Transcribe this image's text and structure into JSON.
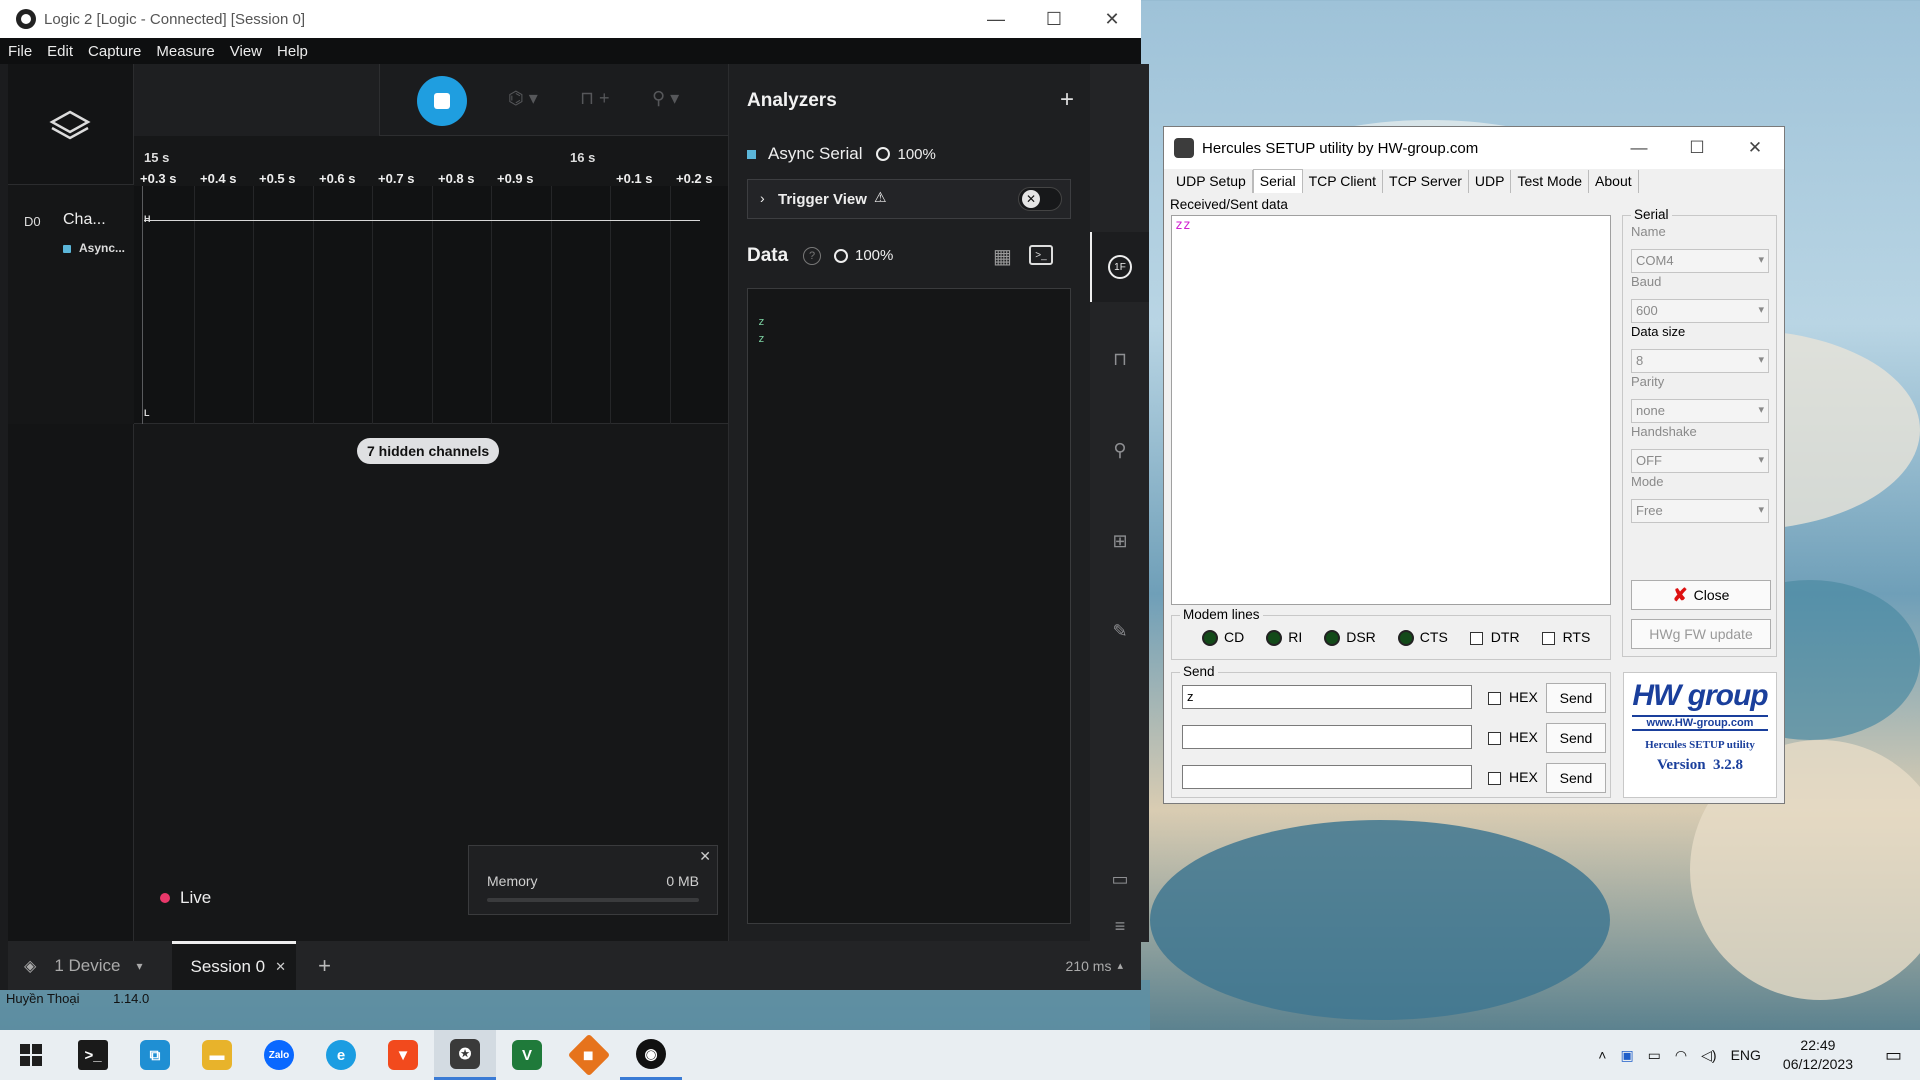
{
  "logic": {
    "title": "Logic 2 [Logic - Connected] [Session 0]",
    "menu": [
      "File",
      "Edit",
      "Capture",
      "Measure",
      "View",
      "Help"
    ],
    "time_major": [
      "15 s",
      "16 s"
    ],
    "time_ticks": [
      "+0.3 s",
      "+0.4 s",
      "+0.5 s",
      "+0.6 s",
      "+0.7 s",
      "+0.8 s",
      "+0.9 s",
      "+0.1 s",
      "+0.2 s"
    ],
    "channel": {
      "id": "D0",
      "name": "Cha...",
      "analyzer": "Async...",
      "high": "H",
      "low": "L"
    },
    "hidden_channels": "7 hidden channels",
    "analyzers_title": "Analyzers",
    "analyzer_item": {
      "name": "Async Serial",
      "pct": "100%"
    },
    "trigger_view": "Trigger View",
    "data_title": "Data",
    "data_pct": "100%",
    "data_lines": [
      "z",
      "z"
    ],
    "memory_label": "Memory",
    "memory_value": "0 MB",
    "memory_usage_fraction": 0,
    "live_label": "Live",
    "device_label": "1 Device",
    "session_tab": "Session 0",
    "latency": "210 ms",
    "accent": "#1f9ee0",
    "live_color": "#e9386a"
  },
  "desktop": {
    "user": "Huyền Thoại",
    "version_text": "1.14.0"
  },
  "hercules": {
    "title": "Hercules SETUP utility by HW-group.com",
    "tabs": [
      "UDP Setup",
      "Serial",
      "TCP Client",
      "TCP Server",
      "UDP",
      "Test Mode",
      "About"
    ],
    "active_tab": "Serial",
    "received_label": "Received/Sent data",
    "received_text": "zz",
    "serial_group": "Serial",
    "fields": [
      {
        "label": "Name",
        "value": "COM4"
      },
      {
        "label": "Baud",
        "value": "600"
      },
      {
        "label": "Data size",
        "value": "8"
      },
      {
        "label": "Parity",
        "value": "none"
      },
      {
        "label": "Handshake",
        "value": "OFF"
      },
      {
        "label": "Mode",
        "value": "Free"
      }
    ],
    "close_btn": "Close",
    "fw_btn": "HWg FW update",
    "modem_group": "Modem lines",
    "modem_leds": [
      "CD",
      "RI",
      "DSR",
      "CTS"
    ],
    "modem_checks": [
      "DTR",
      "RTS"
    ],
    "send_group": "Send",
    "send_rows": [
      {
        "value": "z",
        "hex": "HEX",
        "btn": "Send"
      },
      {
        "value": "",
        "hex": "HEX",
        "btn": "Send"
      },
      {
        "value": "",
        "hex": "HEX",
        "btn": "Send"
      }
    ],
    "logo": {
      "brand": "HW group",
      "url": "www.HW-group.com",
      "product": "Hercules SETUP utility",
      "version": "Version  3.2.8"
    }
  },
  "taskbar": {
    "lang": "ENG",
    "time": "22:49",
    "date": "06/12/2023",
    "apps": [
      "terminal-icon",
      "remote-desktop-icon",
      "file-explorer-icon",
      "zalo-icon",
      "edge-icon",
      "brave-icon",
      "hercules-icon",
      "vscode-like-icon",
      "git-icon",
      "logic-icon"
    ]
  }
}
